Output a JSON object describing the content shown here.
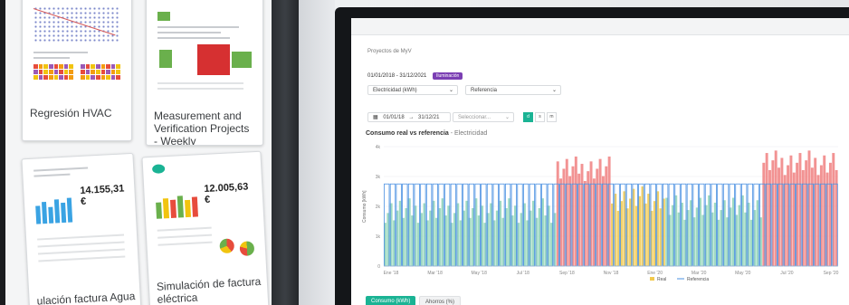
{
  "left": {
    "cards": [
      {
        "title": "Regresión HVAC"
      },
      {
        "title": "Measurement and Verification Projects - Weekly"
      },
      {
        "title": "ulación factura Agua",
        "value": "14.155,31 €"
      },
      {
        "title": "Simulación de factura eléctrica",
        "value": "12.005,63 €"
      }
    ]
  },
  "right": {
    "breadcrumb": "Proyectos de MyV",
    "date_range": "01/01/2018 - 31/12/2021",
    "badge": "Iluminación",
    "select_metric": "Electricidad (kWh)",
    "select_reference": "Referencia",
    "date_from": "01/01/18",
    "date_to": "31/12/21",
    "select_placeholder": "Seleccionar...",
    "granularity": [
      "d",
      "s",
      "m"
    ],
    "chart_title": "Consumo real vs referencia",
    "chart_subtitle": "- Electricidad",
    "tabs": [
      "Consumo (kWh)",
      "Ahorros (%)"
    ]
  },
  "chart_data": {
    "type": "bar",
    "ylabel": "Consumo [kWh]",
    "yticks": [
      "4k",
      "3k",
      "2k",
      "1k",
      "0"
    ],
    "ylim": [
      0,
      4000
    ],
    "xticks": [
      "Ene '18",
      "Mar '18",
      "May '18",
      "Jul '18",
      "Sep '18",
      "Nov '18",
      "Ene '20",
      "Mar '20",
      "May '20",
      "Jul '20",
      "Sep '20"
    ],
    "legend": [
      "Real",
      "Referencia"
    ],
    "colors": {
      "real_high": "#f08080",
      "real_low": "#8fd4b8",
      "real_mid": "#f2c94c",
      "reference": "#4a90e2"
    },
    "reference_level": 2750,
    "real_segments": [
      {
        "x_from": 0.0,
        "x_to": 0.38,
        "level": 1900,
        "color": "real_low"
      },
      {
        "x_from": 0.38,
        "x_to": 0.5,
        "level": 3300,
        "color": "real_high"
      },
      {
        "x_from": 0.5,
        "x_to": 0.62,
        "level": 2300,
        "color": "real_mid"
      },
      {
        "x_from": 0.62,
        "x_to": 0.83,
        "level": 2000,
        "color": "real_low"
      },
      {
        "x_from": 0.83,
        "x_to": 1.0,
        "level": 3500,
        "color": "real_high"
      }
    ]
  }
}
